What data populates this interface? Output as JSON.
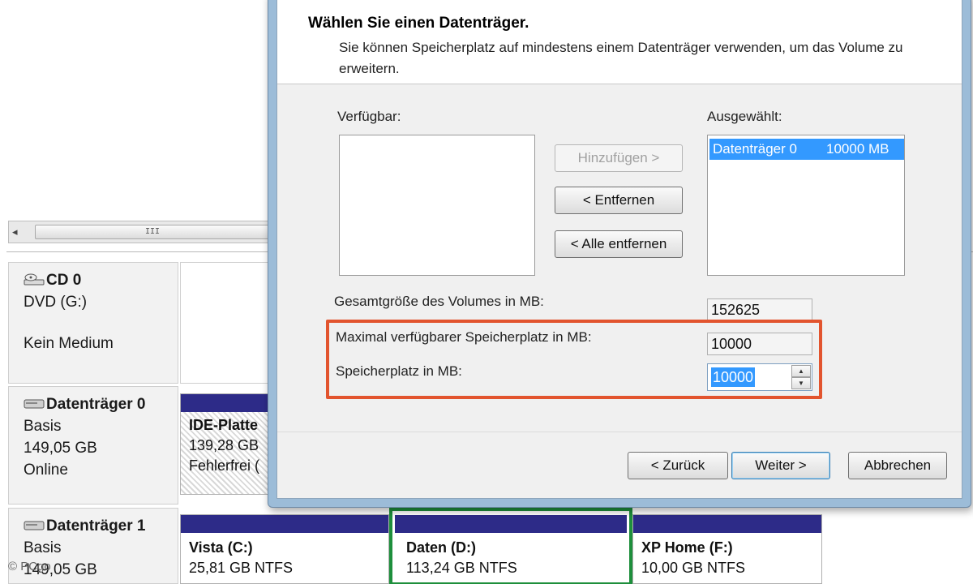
{
  "background": {
    "scroll_glyph": "III",
    "scroll_left_arrow": "◂",
    "disks": [
      {
        "title": "CD 0",
        "type": "DVD (G:)",
        "status": "Kein Medium"
      },
      {
        "title": "Datenträger 0",
        "type": "Basis",
        "size": "149,05 GB",
        "status": "Online"
      },
      {
        "title": "Datenträger 1",
        "type": "Basis",
        "size": "149,05 GB"
      }
    ],
    "disk0_volume": {
      "name": "IDE-Platte",
      "size": "139,28 GB",
      "status": "Fehlerfrei ("
    },
    "disk1_volumes": [
      {
        "name": "Vista (C:)",
        "size": "25,81 GB NTFS"
      },
      {
        "name": "Daten (D:)",
        "size": "113,24 GB NTFS"
      },
      {
        "name": "XP Home (F:)",
        "size": "10,00 GB NTFS"
      }
    ],
    "watermark": "© PCgo"
  },
  "wizard": {
    "title": "Wählen Sie einen Datenträger.",
    "subtitle": "Sie können Speicherplatz auf mindestens einem Datenträger verwenden, um das Volume zu erweitern.",
    "available_label": "Verfügbar:",
    "selected_label": "Ausgewählt:",
    "selected_items": [
      {
        "disk": "Datenträger 0",
        "size": "10000 MB"
      }
    ],
    "buttons": {
      "add": "Hinzufügen >",
      "remove": "< Entfernen",
      "remove_all": "< Alle entfernen",
      "back": "< Zurück",
      "next": "Weiter >",
      "cancel": "Abbrechen"
    },
    "total_size_label": "Gesamtgröße des Volumes in MB:",
    "total_size_value": "152625",
    "max_space_label": "Maximal verfügbarer Speicherplatz in MB:",
    "max_space_value": "10000",
    "space_label": "Speicherplatz in MB:",
    "space_value": "10000",
    "highlight_color": "#e2542e"
  }
}
